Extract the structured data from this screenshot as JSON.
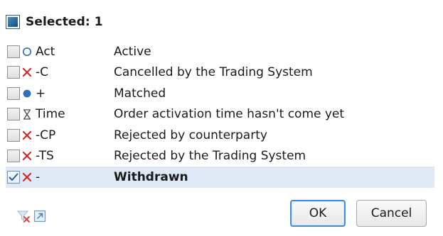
{
  "header": {
    "label": "Selected: 1"
  },
  "rows": [
    {
      "code": "Act",
      "description": "Active",
      "icon": "circle-outline-icon",
      "checked": false
    },
    {
      "code": "-C",
      "description": "Cancelled by the Trading System",
      "icon": "red-x-icon",
      "checked": false
    },
    {
      "code": "+",
      "description": "Matched",
      "icon": "filled-circle-icon",
      "checked": false
    },
    {
      "code": "Time",
      "description": "Order activation time hasn't come yet",
      "icon": "hourglass-icon",
      "checked": false
    },
    {
      "code": "-CP",
      "description": "Rejected by counterparty",
      "icon": "red-x-icon",
      "checked": false
    },
    {
      "code": "-TS",
      "description": "Rejected by the Trading System",
      "icon": "red-x-icon",
      "checked": false
    },
    {
      "code": "-",
      "description": "Withdrawn",
      "icon": "red-x-icon",
      "checked": true
    }
  ],
  "buttons": {
    "ok": "OK",
    "cancel": "Cancel"
  },
  "colors": {
    "selected_row": "#dfe9f5",
    "red_x": "#cc2a2a",
    "blue_circle": "#2f6fb5",
    "default_button_border": "#3f8fd4"
  }
}
